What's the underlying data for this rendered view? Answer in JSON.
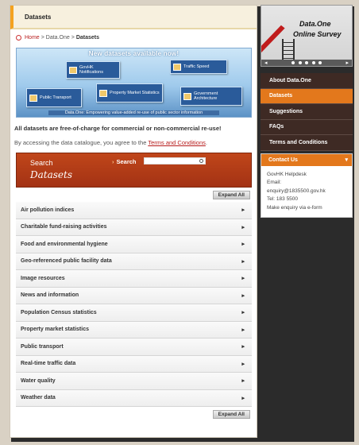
{
  "header": {
    "title": "Datasets"
  },
  "breadcrumb": {
    "home": "Home",
    "sep1": ">",
    "section": "Data.One",
    "sep2": ">",
    "current": "Datasets"
  },
  "banner": {
    "headline": "New datasets available now!",
    "tiles": [
      "GovHK Notifications",
      "Traffic Speed",
      "Public Transport",
      "Property Market Statistics",
      "Government Architecture"
    ],
    "tagline": "Data.One: Empowering value-added re-use of public sector information"
  },
  "intro": {
    "free_text": "All datasets are free-of-charge for commercial or non-commercial re-use!",
    "terms_prefix": "By accessing the data catalogue, you agree to the",
    "terms_link": "Terms and Conditions",
    "terms_suffix": "."
  },
  "search": {
    "line1": "Search",
    "line2": "Datasets",
    "label": "Search",
    "placeholder": ""
  },
  "expand_all": "Expand All",
  "categories": [
    "Air pollution indices",
    "Charitable fund-raising activities",
    "Food and environmental hygiene",
    "Geo-referenced public facility data",
    "Image resources",
    "News and information",
    "Population Census statistics",
    "Property market statistics",
    "Public transport",
    "Real-time traffic data",
    "Water quality",
    "Weather data"
  ],
  "sidebar": {
    "survey": {
      "line1": "Data.One",
      "line2": "Online Survey"
    },
    "nav": [
      {
        "label": "About Data.One",
        "active": false
      },
      {
        "label": "Datasets",
        "active": true
      },
      {
        "label": "Suggestions",
        "active": false
      },
      {
        "label": "FAQs",
        "active": false
      },
      {
        "label": "Terms and Conditions",
        "active": false
      }
    ],
    "contact": {
      "title": "Contact Us",
      "helpdesk": "GovHK Helpdesk",
      "email_label": "Email:",
      "email": "enquiry@1835500.gov.hk",
      "tel": "Tel: 183 5500",
      "eform": "Make enquiry via e-form"
    }
  },
  "colors": {
    "accent_orange": "#e3781c",
    "nav_brown": "#3e2a24",
    "search_red": "#a33214",
    "link_red": "#b71c1c"
  }
}
